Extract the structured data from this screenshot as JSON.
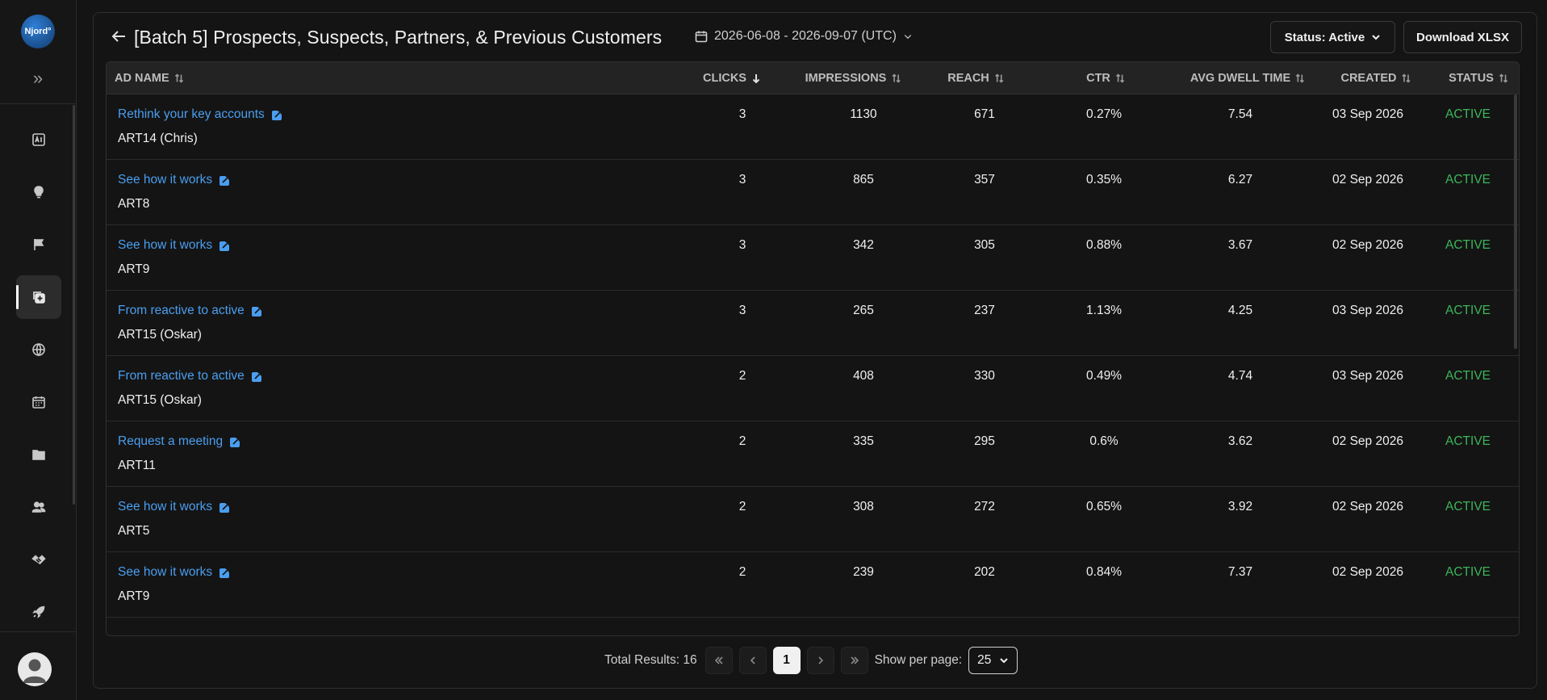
{
  "sidebar": {
    "logo_text": "Njord°",
    "items": [
      {
        "name": "ai-icon",
        "active": false
      },
      {
        "name": "lightbulb-icon",
        "active": false
      },
      {
        "name": "flag-icon",
        "active": false
      },
      {
        "name": "copy-plus-icon",
        "active": true
      },
      {
        "name": "globe-icon",
        "active": false
      },
      {
        "name": "calendar-icon",
        "active": false
      },
      {
        "name": "folder-icon",
        "active": false
      },
      {
        "name": "users-icon",
        "active": false
      },
      {
        "name": "handshake-icon",
        "active": false
      },
      {
        "name": "rocket-icon",
        "active": false
      }
    ]
  },
  "header": {
    "title": "[Batch 5] Prospects, Suspects, Partners, & Previous Customers",
    "date_range": "2026-06-08 - 2026-09-07 (UTC)",
    "status_filter": "Status: Active",
    "download_label": "Download XLSX"
  },
  "table": {
    "columns": [
      {
        "label": "AD NAME",
        "sort": "none"
      },
      {
        "label": "CLICKS",
        "sort": "desc"
      },
      {
        "label": "IMPRESSIONS",
        "sort": "none"
      },
      {
        "label": "REACH",
        "sort": "none"
      },
      {
        "label": "CTR",
        "sort": "none"
      },
      {
        "label": "AVG DWELL TIME",
        "sort": "none"
      },
      {
        "label": "CREATED",
        "sort": "none"
      },
      {
        "label": "STATUS",
        "sort": "none"
      }
    ],
    "rows": [
      {
        "title": "Rethink your key accounts",
        "creative": "ART14 (Chris)",
        "clicks": "3",
        "impressions": "1130",
        "reach": "671",
        "ctr": "0.27%",
        "dwell": "7.54",
        "created": "03 Sep 2026",
        "status": "ACTIVE"
      },
      {
        "title": "See how it works",
        "creative": "ART8",
        "clicks": "3",
        "impressions": "865",
        "reach": "357",
        "ctr": "0.35%",
        "dwell": "6.27",
        "created": "02 Sep 2026",
        "status": "ACTIVE"
      },
      {
        "title": "See how it works",
        "creative": "ART9",
        "clicks": "3",
        "impressions": "342",
        "reach": "305",
        "ctr": "0.88%",
        "dwell": "3.67",
        "created": "02 Sep 2026",
        "status": "ACTIVE"
      },
      {
        "title": "From reactive to active",
        "creative": "ART15 (Oskar)",
        "clicks": "3",
        "impressions": "265",
        "reach": "237",
        "ctr": "1.13%",
        "dwell": "4.25",
        "created": "03 Sep 2026",
        "status": "ACTIVE"
      },
      {
        "title": "From reactive to active",
        "creative": "ART15 (Oskar)",
        "clicks": "2",
        "impressions": "408",
        "reach": "330",
        "ctr": "0.49%",
        "dwell": "4.74",
        "created": "03 Sep 2026",
        "status": "ACTIVE"
      },
      {
        "title": "Request a meeting",
        "creative": "ART11",
        "clicks": "2",
        "impressions": "335",
        "reach": "295",
        "ctr": "0.6%",
        "dwell": "3.62",
        "created": "02 Sep 2026",
        "status": "ACTIVE"
      },
      {
        "title": "See how it works",
        "creative": "ART5",
        "clicks": "2",
        "impressions": "308",
        "reach": "272",
        "ctr": "0.65%",
        "dwell": "3.92",
        "created": "02 Sep 2026",
        "status": "ACTIVE"
      },
      {
        "title": "See how it works",
        "creative": "ART9",
        "clicks": "2",
        "impressions": "239",
        "reach": "202",
        "ctr": "0.84%",
        "dwell": "7.37",
        "created": "02 Sep 2026",
        "status": "ACTIVE"
      }
    ]
  },
  "pagination": {
    "total_label": "Total Results: 16",
    "current_page": "1",
    "per_page_label": "Show per page:",
    "per_page_value": "25"
  },
  "colors": {
    "link": "#4a9eef",
    "status_active": "#3cb55a",
    "background": "#141414"
  }
}
